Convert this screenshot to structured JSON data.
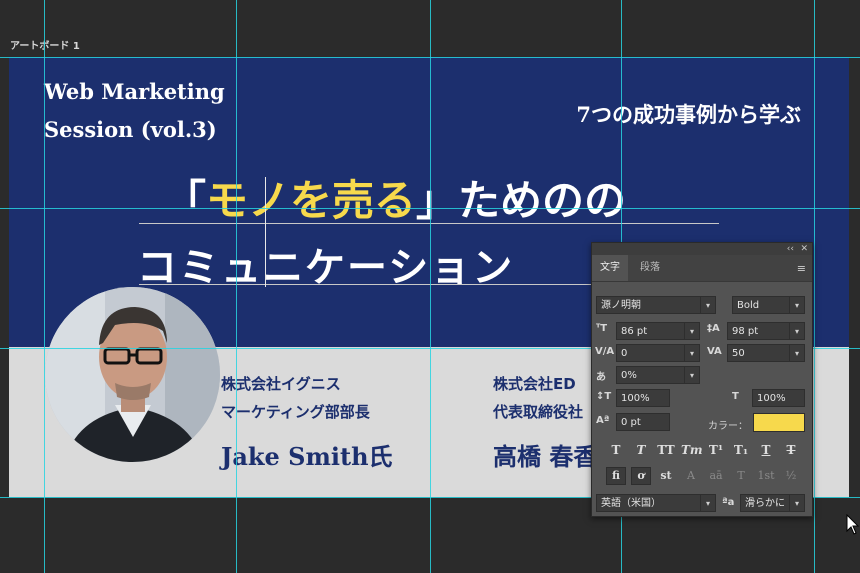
{
  "artboard": {
    "label": "アートボード 1"
  },
  "design": {
    "header_left_line1": "Web Marketing",
    "header_left_line2": "Session (vol.3)",
    "header_right": "7つの成功事例から学ぶ",
    "title_open_bracket": "「",
    "title_accent": "モノを売る",
    "title_close_bracket": "」",
    "title_rest": "ためのの",
    "title_line2": "コミュニケーション",
    "speaker1": {
      "company": "株式会社イグニス",
      "role": "マーケティング部部長",
      "name": "Jake Smith氏"
    },
    "speaker2": {
      "company": "株式会社ED",
      "role": "代表取締役社",
      "name": "高橋 春香"
    }
  },
  "panel": {
    "tab_character": "文字",
    "tab_paragraph": "段落",
    "collapse_glyph": "‹‹",
    "close_glyph": "✕",
    "menu_glyph": "≡",
    "font_family": "源ノ明朝",
    "font_style": "Bold",
    "font_size": "86 pt",
    "leading": "98 pt",
    "kerning": "0",
    "tracking": "50",
    "tsume": "0%",
    "vertical_scale": "100%",
    "horizontal_scale": "100%",
    "baseline_shift": "0 pt",
    "color_label": "カラー：",
    "language": "英語（米国）",
    "antialias": "滑らかに",
    "text_color": "#f7d94c",
    "style_buttons": [
      "T",
      "T",
      "TT",
      "Tт",
      "T¹",
      "T₁",
      "T",
      "T"
    ],
    "opentype_buttons": [
      "fi",
      "ơ",
      "st",
      "A",
      "aā",
      "T",
      "1st",
      "½"
    ]
  }
}
